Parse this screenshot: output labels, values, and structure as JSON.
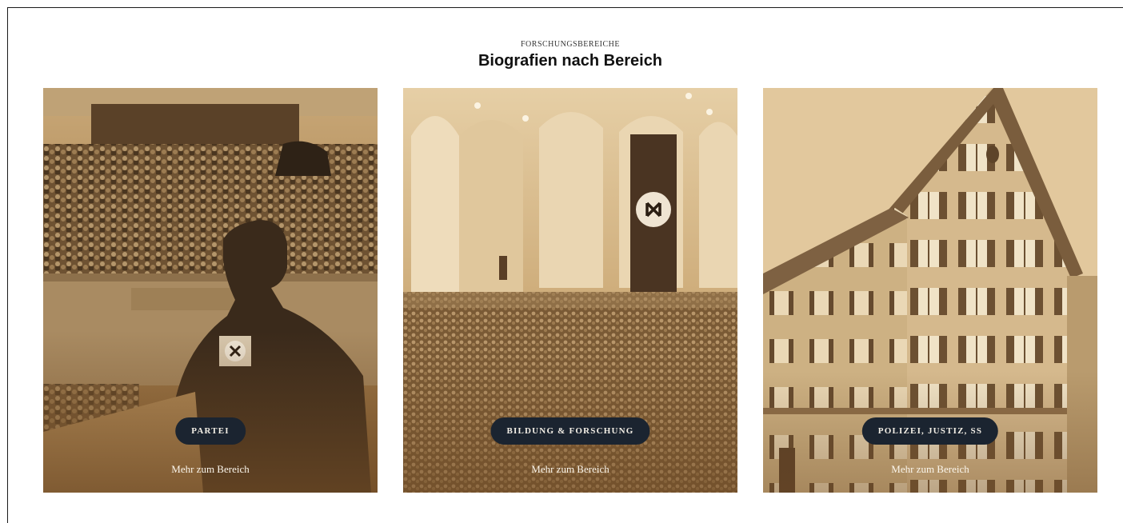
{
  "header": {
    "eyebrow": "FORSCHUNGSBEREICHE",
    "title": "Biografien nach Bereich"
  },
  "cards": [
    {
      "tag": "PARTEI",
      "link": "Mehr zum Bereich",
      "image": "speaker-at-rally-photo"
    },
    {
      "tag": "BILDUNG & FORSCHUNG",
      "link": "Mehr zum Bereich",
      "image": "assembly-hall-crowd-photo"
    },
    {
      "tag": "POLIZEI, JUSTIZ, SS",
      "link": "Mehr zum Bereich",
      "image": "gabled-building-photo"
    }
  ],
  "colors": {
    "pill_bg": "#1b2430",
    "sepia_light": "#e3caa0",
    "sepia_dark": "#6e4a25"
  }
}
